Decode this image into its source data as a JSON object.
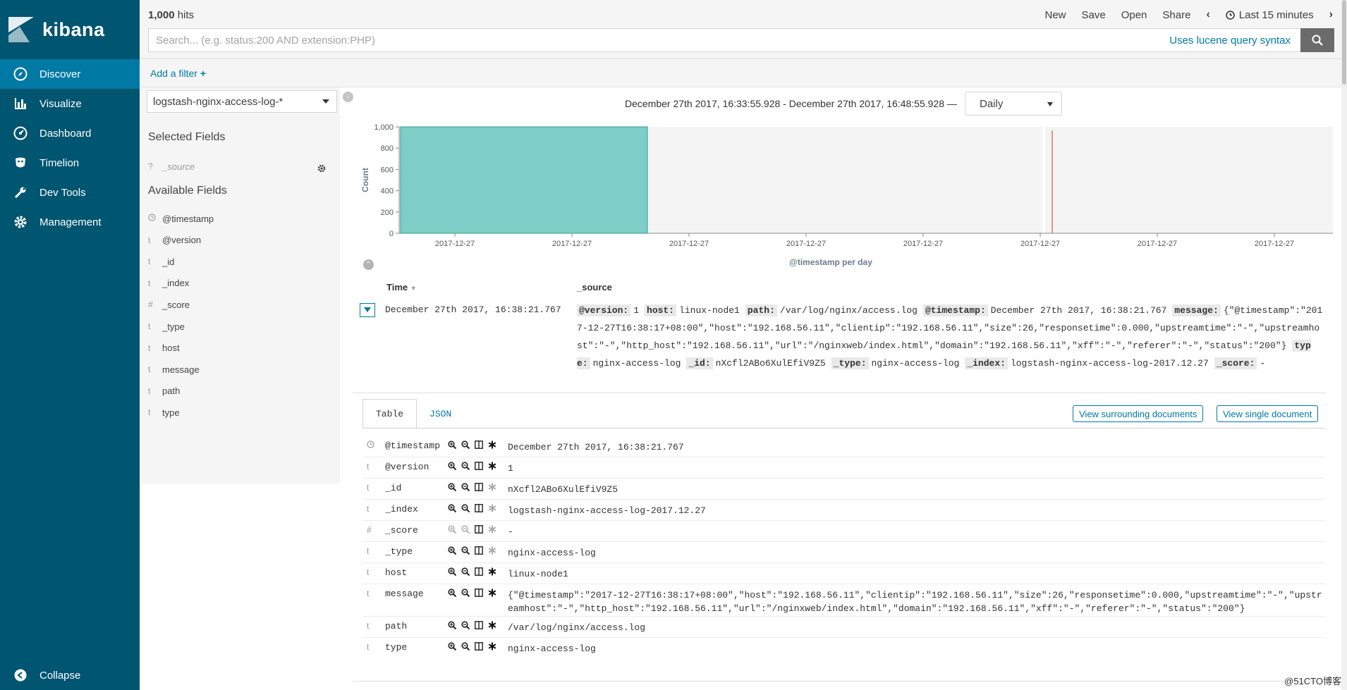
{
  "nav": {
    "brand": "kibana",
    "items": [
      {
        "label": "Discover",
        "icon": "compass-icon",
        "active": true
      },
      {
        "label": "Visualize",
        "icon": "bar-chart-icon",
        "active": false
      },
      {
        "label": "Dashboard",
        "icon": "dashboard-icon",
        "active": false
      },
      {
        "label": "Timelion",
        "icon": "timelion-icon",
        "active": false
      },
      {
        "label": "Dev Tools",
        "icon": "wrench-icon",
        "active": false
      },
      {
        "label": "Management",
        "icon": "gear-icon",
        "active": false
      }
    ],
    "collapse": "Collapse"
  },
  "topbar": {
    "hits_count": "1,000",
    "hits_label": "hits",
    "menu": {
      "new": "New",
      "save": "Save",
      "open": "Open",
      "share": "Share",
      "time": "Last 15 minutes"
    },
    "search_placeholder": "Search... (e.g. status:200 AND extension:PHP)",
    "lucene": "Uses lucene query syntax",
    "add_filter": "Add a filter"
  },
  "sidebar": {
    "index_pattern": "logstash-nginx-access-log-*",
    "selected_title": "Selected Fields",
    "selected": [
      {
        "type": "?",
        "name": "_source"
      }
    ],
    "available_title": "Available Fields",
    "available": [
      {
        "type": "clock",
        "name": "@timestamp"
      },
      {
        "type": "t",
        "name": "@version"
      },
      {
        "type": "t",
        "name": "_id"
      },
      {
        "type": "t",
        "name": "_index"
      },
      {
        "type": "#",
        "name": "_score"
      },
      {
        "type": "t",
        "name": "_type"
      },
      {
        "type": "t",
        "name": "host"
      },
      {
        "type": "t",
        "name": "message"
      },
      {
        "type": "t",
        "name": "path"
      },
      {
        "type": "t",
        "name": "type"
      }
    ]
  },
  "histogram": {
    "range_text": "December 27th 2017, 16:33:55.928 - December 27th 2017, 16:48:55.928 —",
    "interval": "Daily"
  },
  "chart_data": {
    "type": "bar",
    "categories": [
      "2017-12-27",
      "2017-12-27",
      "2017-12-27",
      "2017-12-27",
      "2017-12-27",
      "2017-12-27",
      "2017-12-27",
      "2017-12-27"
    ],
    "values": [
      1000
    ],
    "ylabel": "Count",
    "xlabel": "@timestamp per day",
    "yticks": [
      "0",
      "200",
      "400",
      "600",
      "800",
      "1,000"
    ],
    "ylim": [
      0,
      1000
    ],
    "bar_color": "#7fcdc7",
    "marker_color": "#e07a5f"
  },
  "doc_table": {
    "col_time": "Time",
    "col_source": "_source",
    "row_time": "December 27th 2017, 16:38:21.767",
    "source": [
      {
        "k": "@version:",
        "v": "1"
      },
      {
        "k": "host:",
        "v": "linux-node1"
      },
      {
        "k": "path:",
        "v": "/var/log/nginx/access.log"
      },
      {
        "k": "@timestamp:",
        "v": "December 27th 2017, 16:38:21.767"
      },
      {
        "k": "message:",
        "v": "{\"@timestamp\":\"2017-12-27T16:38:17+08:00\",\"host\":\"192.168.56.11\",\"clientip\":\"192.168.56.11\",\"size\":26,\"responsetime\":0.000,\"upstreamtime\":\"-\",\"upstreamhost\":\"-\",\"http_host\":\"192.168.56.11\",\"url\":\"/nginxweb/index.html\",\"domain\":\"192.168.56.11\",\"xff\":\"-\",\"referer\":\"-\",\"status\":\"200\"}"
      },
      {
        "k": "type:",
        "v": "nginx-access-log"
      },
      {
        "k": "_id:",
        "v": "nXcfl2ABo6XulEfiV9Z5"
      },
      {
        "k": "_type:",
        "v": "nginx-access-log"
      },
      {
        "k": "_index:",
        "v": "logstash-nginx-access-log-2017.12.27"
      },
      {
        "k": "_score:",
        "v": "-"
      }
    ]
  },
  "detail": {
    "tab_table": "Table",
    "tab_json": "JSON",
    "btn_surrounding": "View surrounding documents",
    "btn_single": "View single document",
    "rows": [
      {
        "type": "clock",
        "name": "@timestamp",
        "value": "December 27th 2017, 16:38:21.767",
        "dim": false
      },
      {
        "type": "t",
        "name": "@version",
        "value": "1",
        "dim": false
      },
      {
        "type": "t",
        "name": "_id",
        "value": "nXcfl2ABo6XulEfiV9Z5",
        "dim": true
      },
      {
        "type": "t",
        "name": "_index",
        "value": "logstash-nginx-access-log-2017.12.27",
        "dim": true
      },
      {
        "type": "#",
        "name": "_score",
        "value": " -",
        "dim": true
      },
      {
        "type": "t",
        "name": "_type",
        "value": "nginx-access-log",
        "dim": true
      },
      {
        "type": "t",
        "name": "host",
        "value": "linux-node1",
        "dim": false
      },
      {
        "type": "t",
        "name": "message",
        "value": "{\"@timestamp\":\"2017-12-27T16:38:17+08:00\",\"host\":\"192.168.56.11\",\"clientip\":\"192.168.56.11\",\"size\":26,\"responsetime\":0.000,\"upstreamtime\":\"-\",\"upstreamhost\":\"-\",\"http_host\":\"192.168.56.11\",\"url\":\"/nginxweb/index.html\",\"domain\":\"192.168.56.11\",\"xff\":\"-\",\"referer\":\"-\",\"status\":\"200\"}",
        "dim": false
      },
      {
        "type": "t",
        "name": "path",
        "value": "/var/log/nginx/access.log",
        "dim": false
      },
      {
        "type": "t",
        "name": "type",
        "value": "nginx-access-log",
        "dim": false
      }
    ]
  },
  "watermark": "@51CTO博客"
}
